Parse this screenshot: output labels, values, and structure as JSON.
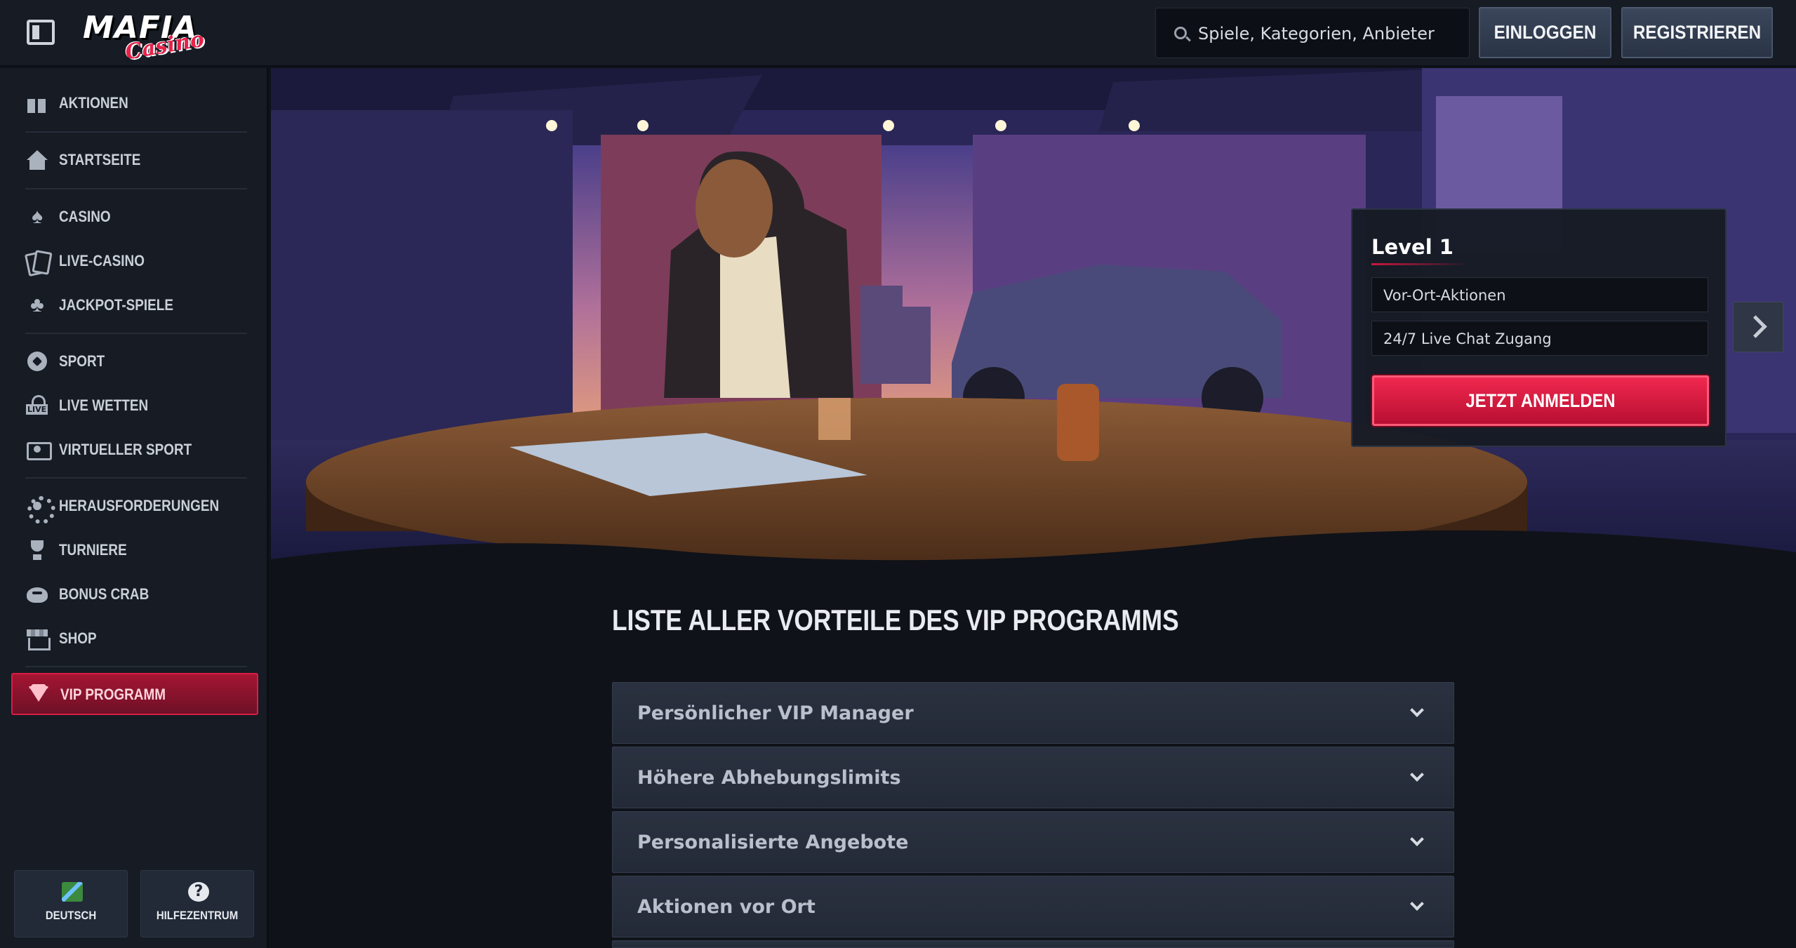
{
  "header": {
    "logo_text": "MAFIA",
    "logo_subtext": "Casino",
    "search_placeholder": "Spiele, Kategorien, Anbieter",
    "login_label": "EINLOGGEN",
    "register_label": "REGISTRIEREN"
  },
  "sidebar": {
    "items": [
      {
        "label": "AKTIONEN",
        "icon": "gift-icon"
      },
      {
        "label": "STARTSEITE",
        "icon": "home-icon"
      },
      {
        "label": "CASINO",
        "icon": "spade-icon"
      },
      {
        "label": "LIVE-CASINO",
        "icon": "cards-icon"
      },
      {
        "label": "JACKPOT-SPIELE",
        "icon": "clover-icon"
      },
      {
        "label": "SPORT",
        "icon": "soccer-ball-icon"
      },
      {
        "label": "LIVE WETTEN",
        "icon": "live-icon"
      },
      {
        "label": "VIRTUELLER SPORT",
        "icon": "virtual-sport-icon"
      },
      {
        "label": "HERAUSFORDERUNGEN",
        "icon": "gear-icon"
      },
      {
        "label": "TURNIERE",
        "icon": "trophy-icon"
      },
      {
        "label": "BONUS CRAB",
        "icon": "crab-icon"
      },
      {
        "label": "SHOP",
        "icon": "shop-icon"
      },
      {
        "label": "VIP PROGRAMM",
        "icon": "diamond-icon",
        "active": true
      }
    ],
    "footer": {
      "language_label": "DEUTSCH",
      "help_label": "HILFEZENTRUM",
      "help_glyph": "?"
    }
  },
  "hero": {
    "level_title": "Level 1",
    "features": [
      "Vor-Ort-Aktionen",
      "24/7 Live Chat Zugang"
    ],
    "cta_label": "JETZT ANMELDEN"
  },
  "main": {
    "section_title": "LISTE ALLER VORTEILE DES VIP PROGRAMMS",
    "benefits": [
      "Persönlicher VIP Manager",
      "Höhere Abhebungslimits",
      "Personalisierte Angebote",
      "Aktionen vor Ort"
    ]
  },
  "colors": {
    "accent": "#e8224a",
    "background": "#0f1218",
    "sidebar": "#161b24"
  }
}
